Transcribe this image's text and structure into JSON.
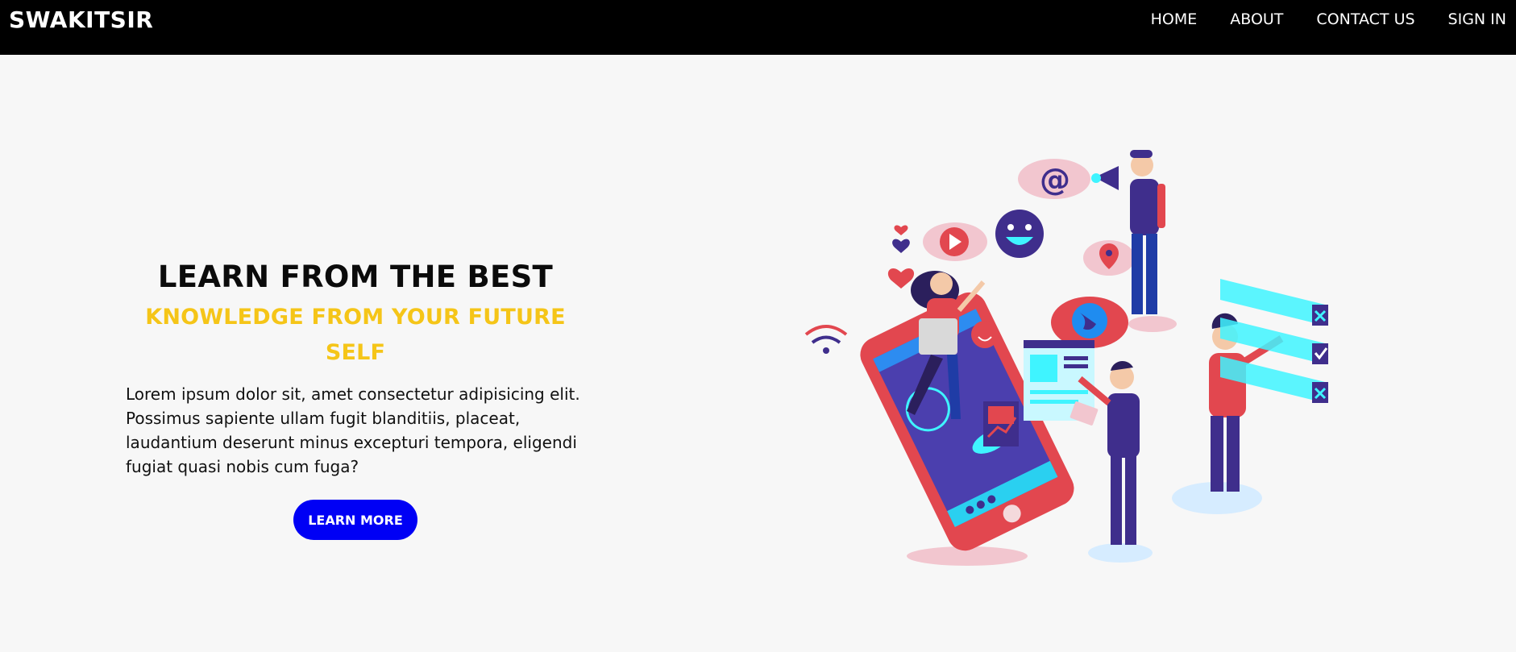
{
  "navbar": {
    "brand": "SWAKITSIR",
    "links": [
      {
        "label": "HOME"
      },
      {
        "label": "ABOUT"
      },
      {
        "label": "CONTACT US"
      },
      {
        "label": "SIGN IN"
      }
    ]
  },
  "hero": {
    "title": "LEARN FROM THE BEST",
    "subtitle": "KNOWLEDGE FROM YOUR FUTURE SELF",
    "text": "Lorem ipsum dolor sit, amet consectetur adipisicing elit. Possimus sapiente ullam fugit blanditiis, placeat, laudantium deserunt minus excepturi tempora, eligendi fugiat quasi nobis cum fuga?",
    "button_label": "LEARN MORE"
  },
  "colors": {
    "navbar_bg": "#000000",
    "page_bg": "#f7f7f7",
    "accent_yellow": "#f5c518",
    "button_blue": "#0000f5",
    "illustration_red": "#e2474f",
    "illustration_purple": "#3f2e8c",
    "illustration_cyan": "#3ff4ff"
  },
  "illustration": {
    "name": "digital-marketing-illustration"
  }
}
